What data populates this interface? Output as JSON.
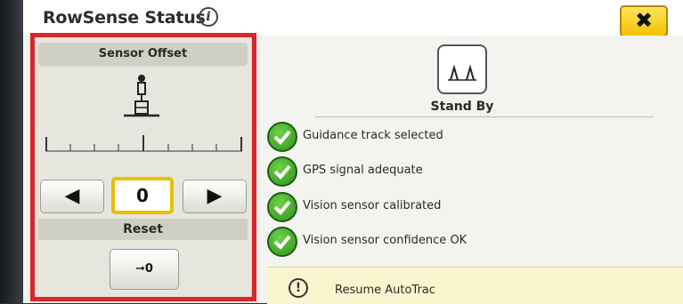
{
  "window": {
    "title": "RowSense Status",
    "info_icon": "info-icon",
    "close_label": "✖"
  },
  "sensor_offset": {
    "header": "Sensor Offset",
    "left_arrow": "◀",
    "value": "0",
    "right_arrow": "▶",
    "reset_label": "Reset",
    "zero_button_label": "➞0"
  },
  "status": {
    "mode_label": "Stand By",
    "checks": [
      {
        "label": "Guidance track selected",
        "icon": "check-icon"
      },
      {
        "label": "GPS signal adequate",
        "icon": "check-icon"
      },
      {
        "label": "Vision sensor calibrated",
        "icon": "check-icon"
      },
      {
        "label": "Vision sensor confidence OK",
        "icon": "check-icon"
      }
    ],
    "resume": {
      "icon_glyph": "!",
      "label": "Resume AutoTrac"
    }
  },
  "colors": {
    "highlight": "#d8262a",
    "close_button": "#f2c200",
    "check_green": "#2f8f1c",
    "resume_bg": "#fbf5cf"
  }
}
